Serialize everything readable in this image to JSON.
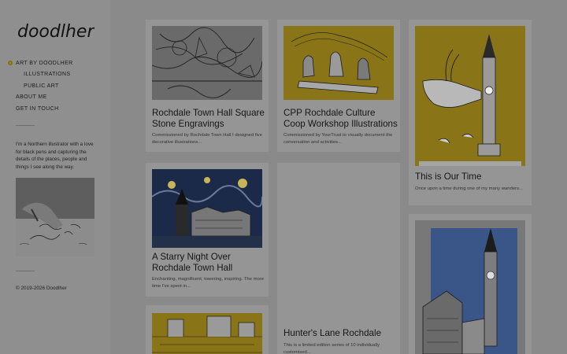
{
  "site": {
    "logo_text": "doodlher",
    "bio": "I'm a Northern illustrator with a love for black pens and capturing the details of the places, people and things I see along the way.",
    "copyright": "© 2019-2026 Doodlher",
    "accent_color": "#c5a21a"
  },
  "nav": {
    "items": [
      {
        "label": "ART BY DOODLHER",
        "active": true
      },
      {
        "label": "ILLUSTRATIONS"
      },
      {
        "label": "PUBLIC ART"
      },
      {
        "label": "ABOUT ME"
      },
      {
        "label": "GET IN TOUCH"
      }
    ]
  },
  "cards": [
    {
      "title": "Rochdale Town Hall Square Stone Engravings",
      "desc": "Commissioned by Rochdale Town Hall I designed five decorative illustrations..."
    },
    {
      "title": "CPP Rochdale Culture Coop Workshop Illustrations",
      "desc": "Commissioned by YourTrust to visually document the conversation and activities..."
    },
    {
      "title": "This is Our Time",
      "desc": "Once upon a time during one of my many wanders..."
    },
    {
      "title": "A Starry Night Over Rochdale Town Hall",
      "desc": "Enchanting, magnificent, towering, inspiring. The more time I've spent in..."
    },
    {
      "title": "Hunter's Lane Rochdale",
      "desc": "This is a limited edition series of 10 individually customised..."
    }
  ]
}
